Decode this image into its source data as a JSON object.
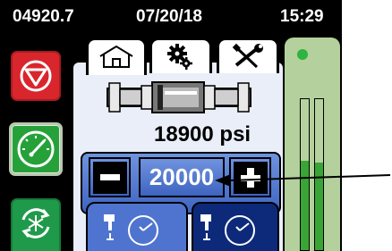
{
  "status_bar": {
    "counter": "04920.7",
    "date": "07/20/18",
    "time": "15:29"
  },
  "tabs": [
    {
      "icon": "home-icon",
      "selected": true
    },
    {
      "icon": "gears-icon",
      "selected": false
    },
    {
      "icon": "tools-icon",
      "selected": false
    }
  ],
  "side_buttons": [
    {
      "icon": "stop-icon",
      "color": "#d8262c"
    },
    {
      "icon": "pressure-gauge-icon",
      "color": "#26a13a",
      "selected": true
    },
    {
      "icon": "recirculate-snowflake-icon",
      "color": "#1f9a4a"
    }
  ],
  "pressure": {
    "value": "18900",
    "unit": "psi"
  },
  "setpoint": {
    "value": "20000",
    "decrease_label": "−",
    "increase_label": "+"
  },
  "mode_tiles": [
    {
      "icon": "pump-gauge-icon",
      "color": "#4f74cf"
    },
    {
      "icon": "pump-gauge-icon",
      "color": "#0d2a7a"
    }
  ],
  "level_bars": {
    "indicator_color": "#2fb343",
    "left_level": 0.59,
    "right_level": 0.58
  }
}
